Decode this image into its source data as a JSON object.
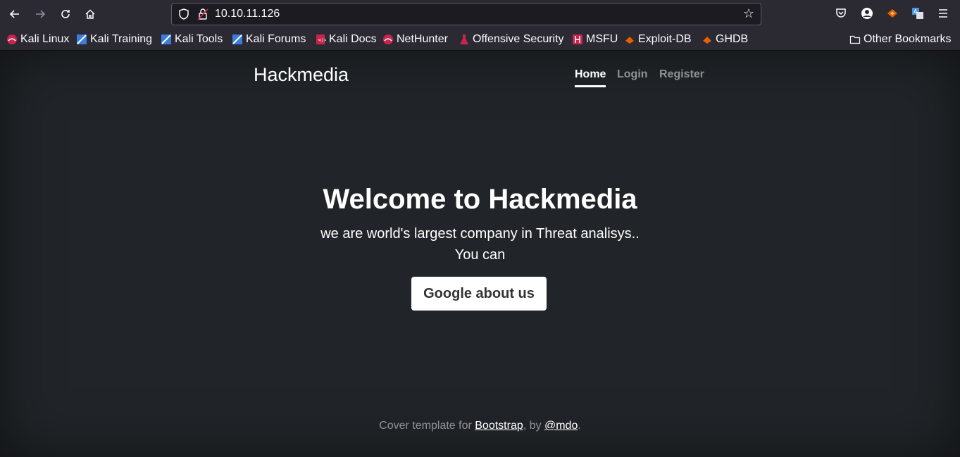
{
  "browser": {
    "url": "10.10.11.126",
    "bookmarks": [
      {
        "label": "Kali Linux",
        "icon": "kali-icon"
      },
      {
        "label": "Kali Training",
        "icon": "kali-training-icon"
      },
      {
        "label": "Kali Tools",
        "icon": "kali-tools-icon"
      },
      {
        "label": "Kali Forums",
        "icon": "kali-forums-icon"
      },
      {
        "label": "Kali Docs",
        "icon": "kali-docs-icon"
      },
      {
        "label": "NetHunter",
        "icon": "nethunter-icon"
      },
      {
        "label": "Offensive Security",
        "icon": "offsec-icon"
      },
      {
        "label": "MSFU",
        "icon": "msfu-icon"
      },
      {
        "label": "Exploit-DB",
        "icon": "exploitdb-icon"
      },
      {
        "label": "GHDB",
        "icon": "ghdb-icon"
      }
    ],
    "other_bookmarks": "Other Bookmarks"
  },
  "site": {
    "brand": "Hackmedia",
    "nav": [
      {
        "label": "Home",
        "active": true
      },
      {
        "label": "Login",
        "active": false
      },
      {
        "label": "Register",
        "active": false
      }
    ],
    "hero": {
      "title": "Welcome to Hackmedia",
      "line1": "we are world's largest company in Threat analisys..",
      "line2": "You can",
      "button": "Google about us"
    },
    "footer": {
      "prefix": "Cover template for ",
      "link1": "Bootstrap",
      "middle": ", by ",
      "link2": "@mdo",
      "suffix": "."
    }
  },
  "colors": {
    "page_bg": "#212529",
    "chrome_bg": "#2b2a33",
    "text": "#ffffff"
  }
}
